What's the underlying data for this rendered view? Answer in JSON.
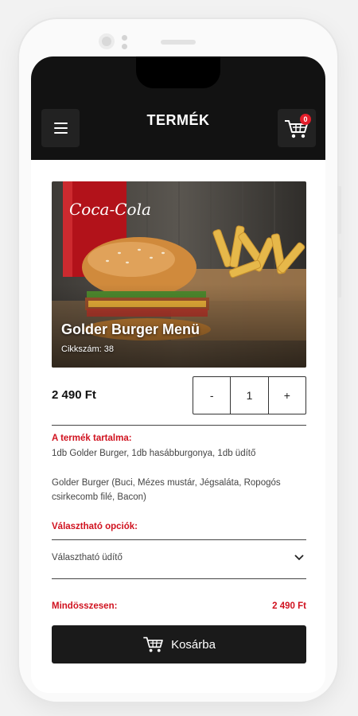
{
  "header": {
    "title": "TERMÉK",
    "menu_icon": "hamburger-menu-icon",
    "cart_icon": "shopping-cart-icon",
    "cart_badge": "0"
  },
  "product": {
    "name": "Golder Burger Menü",
    "meta": "Cikkszám: 38",
    "price": "2 490 Ft",
    "image_icon": "burger-menu-photo"
  },
  "quantity": {
    "minus": "-",
    "value": "1",
    "plus": "+"
  },
  "contents": {
    "label": "A termék tartalma:",
    "line": "1db Golder Burger, 1db hasábburgonya, 1db üdítő",
    "detail": "Golder Burger (Buci, Mézes mustár, Jégsaláta, Ropogós csirkecomb filé, Bacon)"
  },
  "options": {
    "label": "Választható opciók:",
    "select_label": "Választható üdítő"
  },
  "total": {
    "label": "Mindösszesen:",
    "value": "2 490 Ft"
  },
  "add_to_cart": {
    "label": "Kosárba"
  },
  "colors": {
    "accent": "#d0121f",
    "dark": "#121212",
    "button": "#1a1a1a"
  }
}
